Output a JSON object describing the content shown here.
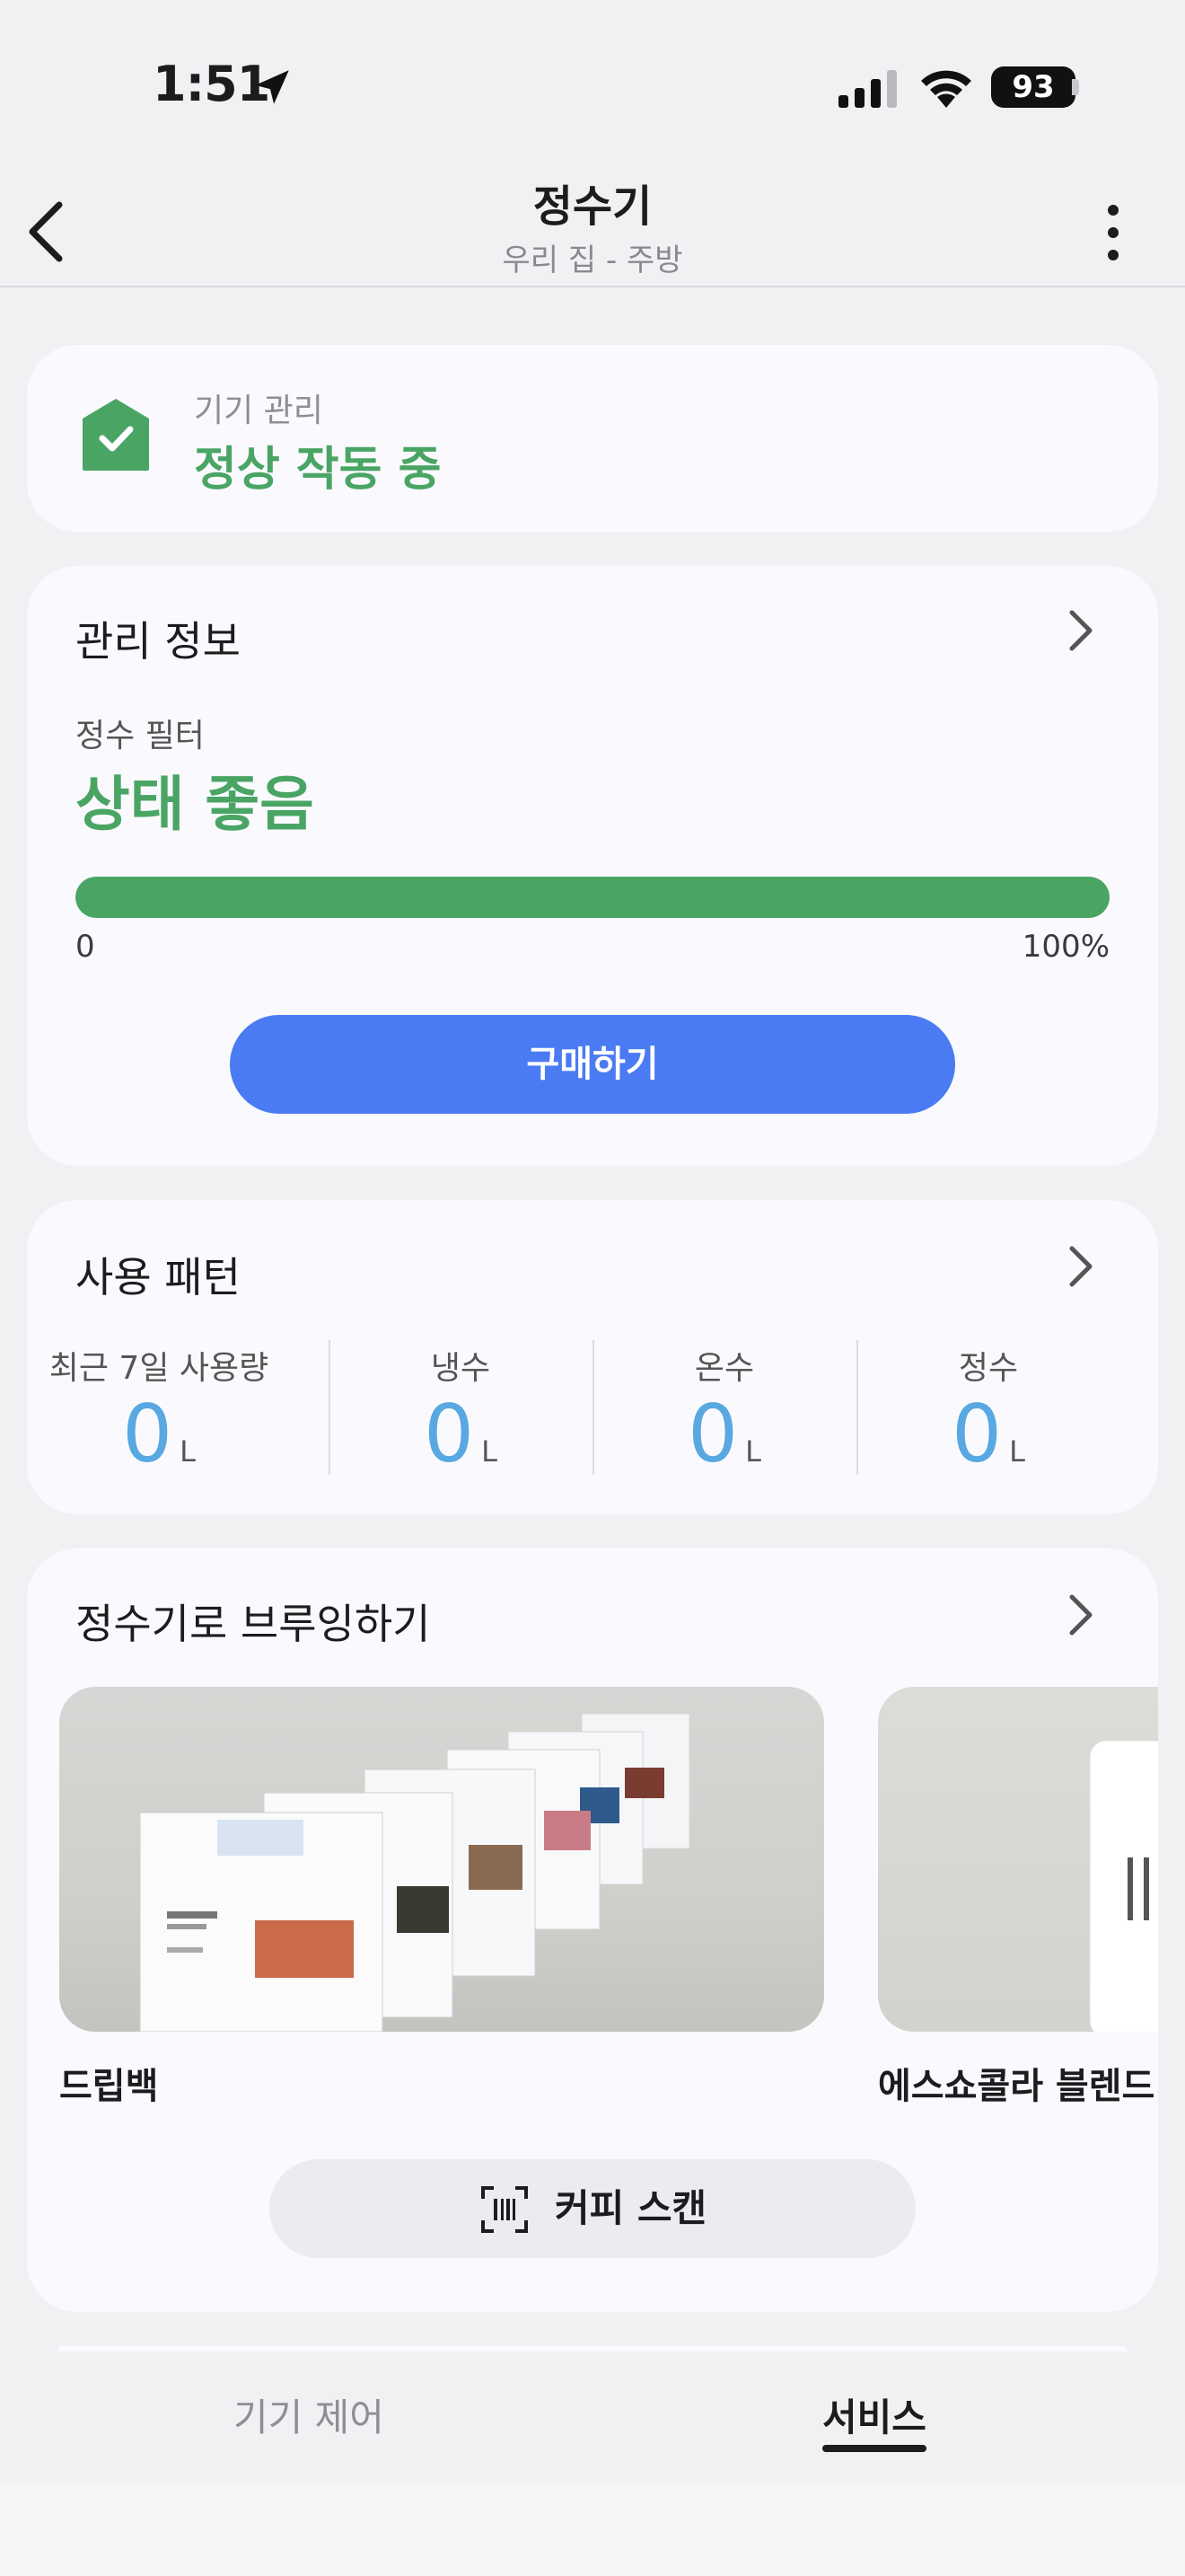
{
  "status_bar": {
    "time": "1:51",
    "battery": "93"
  },
  "header": {
    "title": "정수기",
    "subtitle": "우리 집 - 주방"
  },
  "device_card": {
    "label": "기기 관리",
    "status": "정상 작동 중",
    "status_color": "#4aa564"
  },
  "management": {
    "title": "관리 정보",
    "filter_label": "정수 필터",
    "filter_status": "상태 좋음",
    "progress_percent": 100,
    "progress_min": "0",
    "progress_max": "100%",
    "buy_label": "구매하기",
    "accent": "#4b7bf3"
  },
  "usage": {
    "title": "사용 패턴",
    "stats": [
      {
        "label": "최근 7일 사용량",
        "value": "0",
        "unit": "L"
      },
      {
        "label": "냉수",
        "value": "0",
        "unit": "L"
      },
      {
        "label": "온수",
        "value": "0",
        "unit": "L"
      },
      {
        "label": "정수",
        "value": "0",
        "unit": "L"
      }
    ]
  },
  "brewing": {
    "title": "정수기로 브루잉하기",
    "items": [
      {
        "name": "드립백"
      },
      {
        "name": "에스쇼콜라 블렌드"
      }
    ],
    "scan_label": "커피 스캔"
  },
  "tabs": {
    "control": "기기 제어",
    "service": "서비스"
  }
}
